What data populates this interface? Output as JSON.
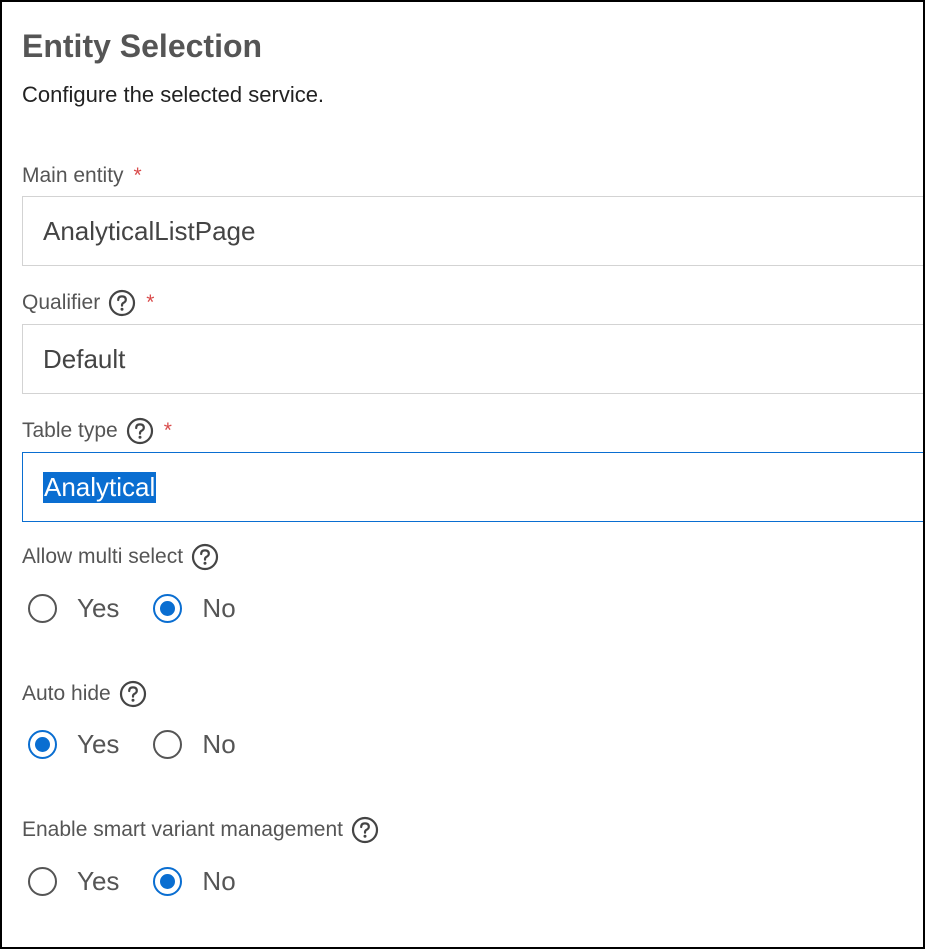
{
  "header": {
    "title": "Entity Selection",
    "subtitle": "Configure the selected service."
  },
  "fields": {
    "main_entity": {
      "label": "Main entity",
      "required_mark": "*",
      "value": "AnalyticalListPage"
    },
    "qualifier": {
      "label": "Qualifier",
      "required_mark": "*",
      "value": "Default"
    },
    "table_type": {
      "label": "Table type",
      "required_mark": "*",
      "value": "Analytical"
    }
  },
  "options": {
    "allow_multi_select": {
      "label": "Allow multi select",
      "yes": "Yes",
      "no": "No",
      "selected": "No"
    },
    "auto_hide": {
      "label": "Auto hide",
      "yes": "Yes",
      "no": "No",
      "selected": "Yes"
    },
    "smart_variant": {
      "label": "Enable smart variant management",
      "yes": "Yes",
      "no": "No",
      "selected": "No"
    }
  },
  "icons": {
    "help": "question-circle-icon"
  },
  "colors": {
    "accent": "#0a6ed1",
    "required": "#d94b4b",
    "border": "#d3d3d3"
  }
}
